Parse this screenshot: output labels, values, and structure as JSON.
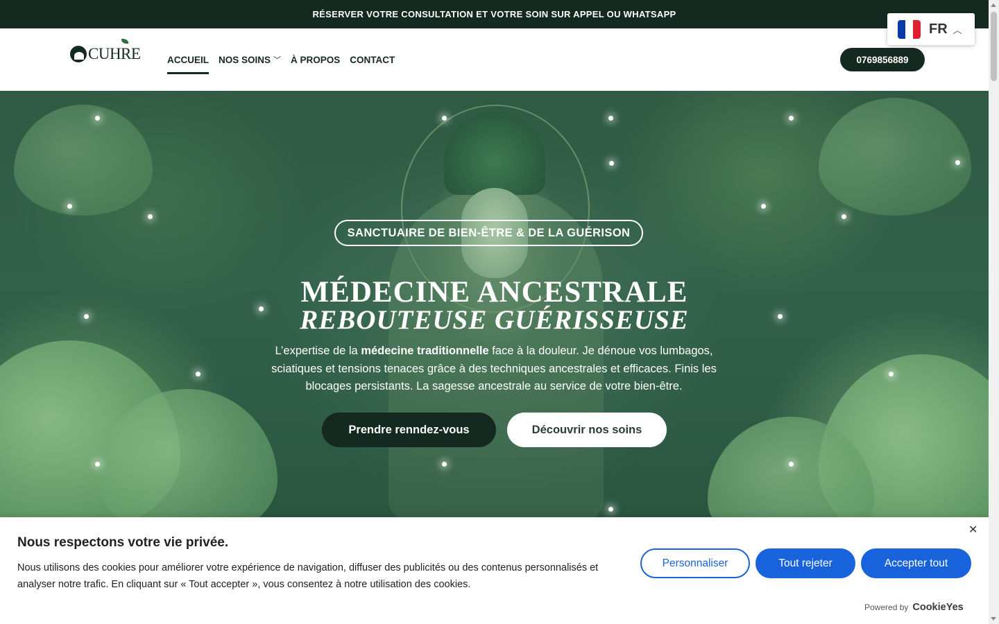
{
  "announcement": "RÉSERVER VOTRE CONSULTATION ET VOTRE SOIN SUR APPEL OU WHATSAPP",
  "logo": {
    "text": "CUHRE"
  },
  "nav": {
    "items": [
      {
        "label": "ACCUEIL",
        "active": true
      },
      {
        "label": "NOS SOINS",
        "has_dropdown": true
      },
      {
        "label": "À PROPOS"
      },
      {
        "label": "CONTACT"
      }
    ]
  },
  "phone": "0769856889",
  "language": {
    "code": "FR",
    "flag": "france-flag-icon"
  },
  "hero": {
    "badge": "SANCTUAIRE DE BIEN-ÊTRE & DE LA GUÉRISON",
    "title_line1": "MÉDECINE ANCESTRALE",
    "title_line2": "REBOUTEUSE GUÉRISSEUSE",
    "description": {
      "part1": "L’expertise de la ",
      "bold": "médecine traditionnelle",
      "part2": " face à la douleur. Je dénoue vos lumbagos, sciatiques et tensions tenaces grâce à des techniques ancestrales et efficaces. Finis les blocages persistants. La sagesse ancestrale au service de votre bien-être."
    },
    "primary_button": "Prendre renndez-vous",
    "secondary_button": "Découvrir nos soins"
  },
  "cookie": {
    "title": "Nous respectons votre vie privée.",
    "text": "Nous utilisons des cookies pour améliorer votre expérience de navigation, diffuser des publicités ou des contenus personnalisés et analyser notre trafic. En cliquant sur « Tout accepter », vous consentez à notre utilisation des cookies.",
    "personalize": "Personnaliser",
    "reject": "Tout rejeter",
    "accept": "Accepter tout",
    "powered_by": "Powered by",
    "brand": "CookieYes",
    "close_icon": "close-icon"
  },
  "colors": {
    "dark_green": "#14291f",
    "cookie_blue": "#1863dc",
    "hero_green": "#33614a"
  }
}
